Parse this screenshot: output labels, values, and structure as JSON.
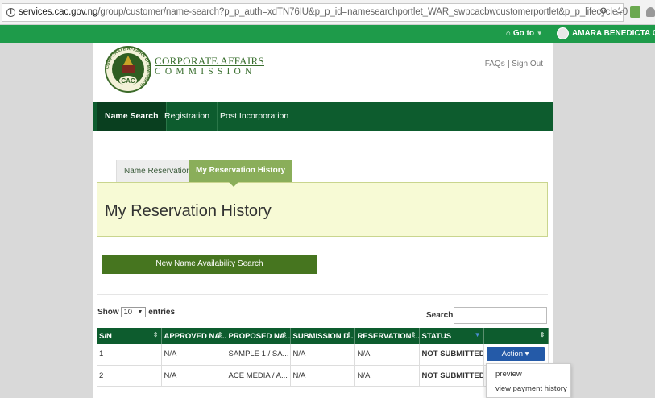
{
  "browser": {
    "url_host": "services.cac.gov.ng",
    "url_path": "/group/customer/name-search?p_p_auth=xdTN76IU&p_p_id=namesearchportlet_WAR_swpcacbwcustomerportlet&p_p_lifecycle=0",
    "info_glyph": "i",
    "zoom_glyph": "⚲",
    "star_glyph": "☆"
  },
  "topbar": {
    "home_glyph": "⌂",
    "goto_label": "Go to",
    "goto_caret": "▼",
    "user_name": "AMARA BENEDICTA OKAF",
    "color": "#1e9b4a"
  },
  "header": {
    "logo_title": "CORPORATE AFFAIRS",
    "logo_sub": "COMMISSION",
    "logo_badge": "CAC",
    "logo_ring_text": "CORPORATE AFFAIRS COMMISSION",
    "faqs_label": "FAQs",
    "sep": "|",
    "signout_label": "Sign Out"
  },
  "nav": {
    "items": [
      {
        "label": "Name Search"
      },
      {
        "label": "Registration"
      },
      {
        "label": "Post Incorporation"
      }
    ],
    "color": "#0d5c2e"
  },
  "tabs": {
    "items": [
      {
        "label": "Name Reservation"
      },
      {
        "label": "My Reservation History"
      }
    ]
  },
  "main": {
    "title": "My Reservation History",
    "search_button": "New Name Availability Search"
  },
  "table_controls": {
    "show_label": "Show",
    "entries_value": "10",
    "select_caret": "▼",
    "entries_label": "entries",
    "search_label": "Search:",
    "search_value": ""
  },
  "table": {
    "columns": [
      "S/N",
      "APPROVED NA...",
      "PROPOSED NA...",
      "SUBMISSION D...",
      "RESERVATION ...",
      "STATUS",
      ""
    ],
    "sort_glyph": "⇕",
    "sort_active_glyph": "▼",
    "rows": [
      {
        "sn": "1",
        "approved": "N/A",
        "proposed": "SAMPLE 1 / SA...",
        "submission": "N/A",
        "reservation": "N/A",
        "status": "NOT SUBMITTED",
        "action": "Action ▾"
      },
      {
        "sn": "2",
        "approved": "N/A",
        "proposed": "ACE MEDIA / A...",
        "submission": "N/A",
        "reservation": "N/A",
        "status": "NOT SUBMITTED",
        "action": ""
      }
    ]
  },
  "dropdown": {
    "items": [
      "preview",
      "view payment history"
    ]
  }
}
